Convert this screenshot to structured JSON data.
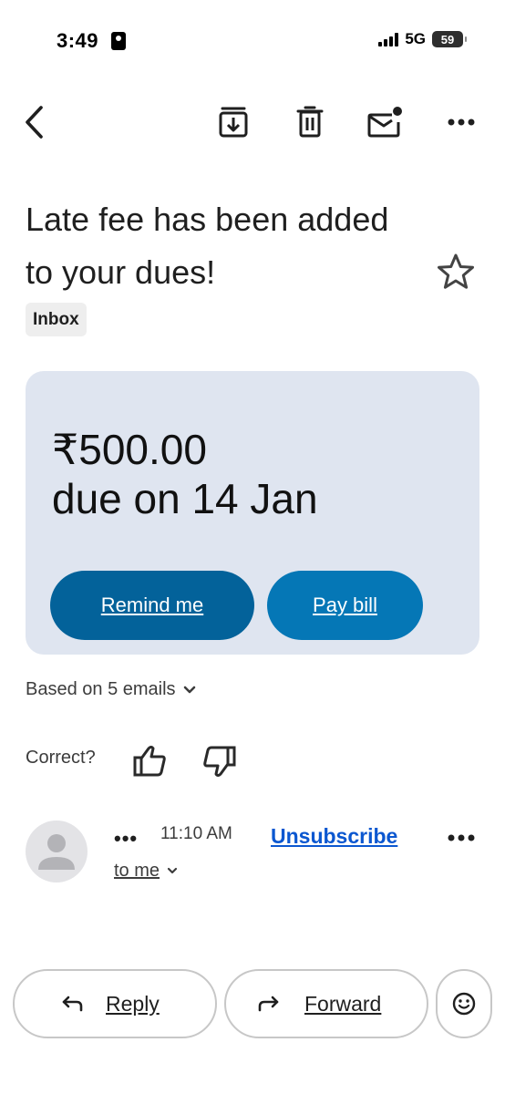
{
  "status_bar": {
    "time": "3:49",
    "network": "5G",
    "battery": "59"
  },
  "toolbar": {
    "icons": [
      "back-arrow-icon",
      "archive-icon",
      "trash-icon",
      "mark-unread-icon",
      "more-icon"
    ]
  },
  "email": {
    "subject": "Late fee has been added to your dues!",
    "label": "Inbox"
  },
  "bill_card": {
    "amount": "₹500.00",
    "due": "due on 14 Jan",
    "remind_label": "Remind me",
    "pay_label": "Pay bill",
    "colors": {
      "card_bg": "#dfe5f0",
      "remind_bg": "#03629a",
      "pay_bg": "#0577b6"
    }
  },
  "summary": {
    "based_on": "Based on 5 emails",
    "correct_prompt": "Correct?"
  },
  "message": {
    "sender": "•••",
    "time": "11:10 AM",
    "unsubscribe": "Unsubscribe",
    "recipient": "to me"
  },
  "actions": {
    "reply": "Reply",
    "forward": "Forward"
  }
}
